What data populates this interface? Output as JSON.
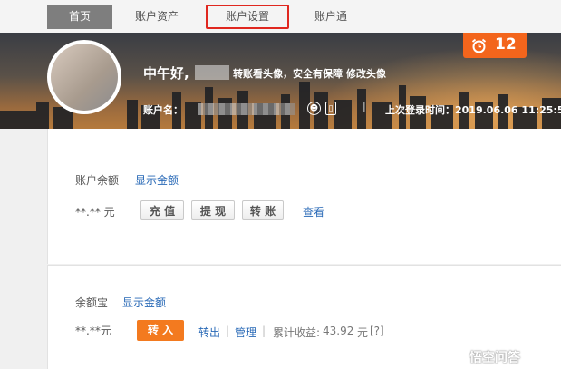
{
  "nav": {
    "tabs": [
      "首页",
      "账户资产",
      "账户设置",
      "账户通"
    ]
  },
  "banner": {
    "greeting": "中午好,",
    "greeting_links": "转账看头像，安全有保障 修改头像",
    "account_label": "账户名：",
    "separator": "|",
    "last_login": "上次登录时间：2019.06.06 11:25:5",
    "message_count": "12"
  },
  "balance": {
    "label": "账户余额",
    "show_link": "显示金额",
    "amount": "**.** 元",
    "recharge": "充 值",
    "withdraw": "提 现",
    "transfer": "转 账",
    "view": "查看"
  },
  "yuebao": {
    "label": "余额宝",
    "show_link": "显示金额",
    "amount": "**.**元",
    "transfer_in": "转 入",
    "transfer_out": "转出",
    "manage": "管理",
    "earnings_label": "累计收益:",
    "earnings_value": "43.92",
    "unit": "元",
    "help": "[?]"
  },
  "watermark": "悟空问答",
  "colors": {
    "accent": "#f37a1f",
    "link": "#2a6ab7",
    "highlight_border": "#e0271f"
  }
}
